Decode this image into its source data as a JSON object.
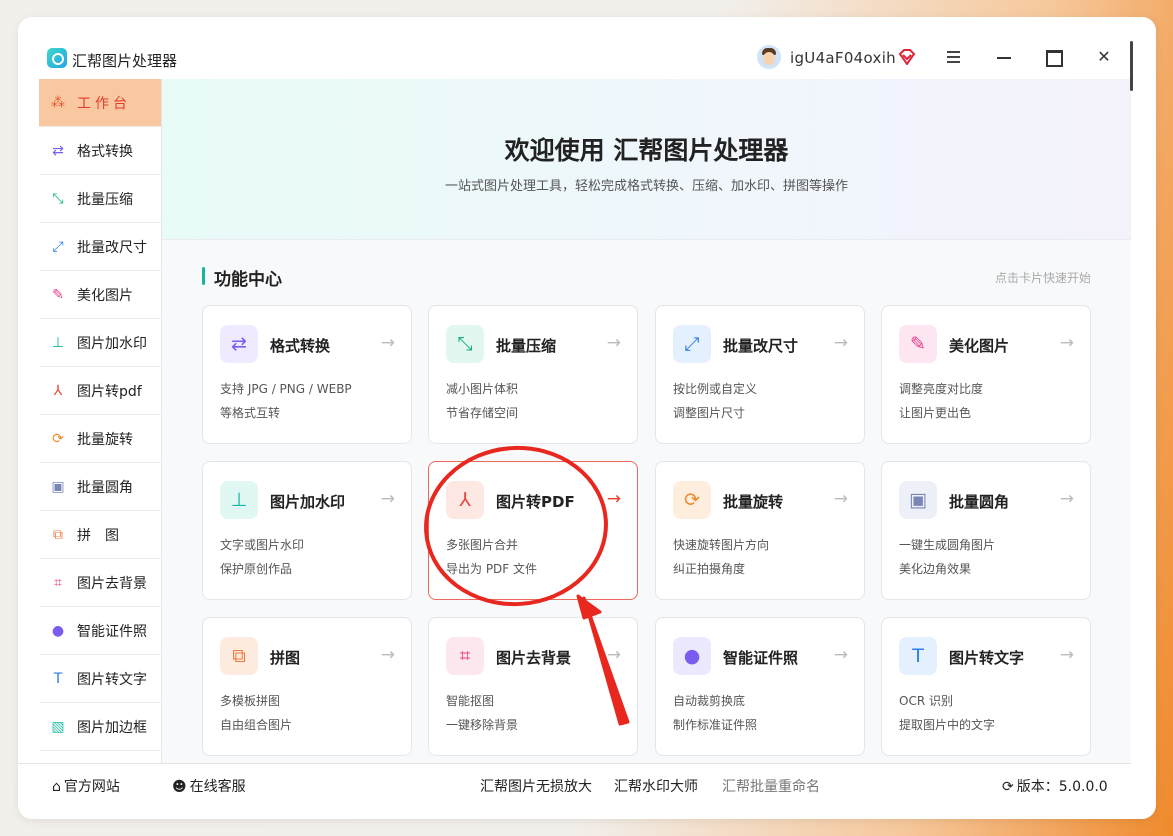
{
  "app": {
    "title": "汇帮图片处理器",
    "username": "igU4aF04oxih"
  },
  "sidebar": {
    "items": [
      {
        "label": "工作台",
        "icon": "grid-icon"
      },
      {
        "label": "格式转换",
        "icon": "format-convert-icon"
      },
      {
        "label": "批量压缩",
        "icon": "compress-icon"
      },
      {
        "label": "批量改尺寸",
        "icon": "resize-icon"
      },
      {
        "label": "美化图片",
        "icon": "beautify-icon"
      },
      {
        "label": "图片加水印",
        "icon": "watermark-icon"
      },
      {
        "label": "图片转pdf",
        "icon": "pdf-icon"
      },
      {
        "label": "批量旋转",
        "icon": "rotate-icon"
      },
      {
        "label": "批量圆角",
        "icon": "round-corner-icon"
      },
      {
        "label": "拼　图",
        "icon": "collage-icon"
      },
      {
        "label": "图片去背景",
        "icon": "crop-icon"
      },
      {
        "label": "智能证件照",
        "icon": "person-icon"
      },
      {
        "label": "图片转文字",
        "icon": "text-icon"
      },
      {
        "label": "图片加边框",
        "icon": "frame-icon"
      }
    ]
  },
  "hero": {
    "title": "欢迎使用 汇帮图片处理器",
    "subtitle": "一站式图片处理工具，轻松完成格式转换、压缩、加水印、拼图等操作"
  },
  "section": {
    "title": "功能中心",
    "hint": "点击卡片快速开始"
  },
  "cards": [
    {
      "title": "格式转换",
      "d1": "支持 JPG / PNG / WEBP",
      "d2": "等格式互转",
      "icon": "format-convert-icon"
    },
    {
      "title": "批量压缩",
      "d1": "减小图片体积",
      "d2": "节省存储空间",
      "icon": "compress-icon"
    },
    {
      "title": "批量改尺寸",
      "d1": "按比例或自定义",
      "d2": "调整图片尺寸",
      "icon": "resize-icon"
    },
    {
      "title": "美化图片",
      "d1": "调整亮度对比度",
      "d2": "让图片更出色",
      "icon": "beautify-icon"
    },
    {
      "title": "图片加水印",
      "d1": "文字或图片水印",
      "d2": "保护原创作品",
      "icon": "watermark-icon"
    },
    {
      "title": "图片转PDF",
      "d1": "多张图片合并",
      "d2": "导出为 PDF 文件",
      "icon": "pdf-icon"
    },
    {
      "title": "批量旋转",
      "d1": "快速旋转图片方向",
      "d2": "纠正拍摄角度",
      "icon": "rotate-icon"
    },
    {
      "title": "批量圆角",
      "d1": "一键生成圆角图片",
      "d2": "美化边角效果",
      "icon": "round-corner-icon"
    },
    {
      "title": "拼图",
      "d1": "多模板拼图",
      "d2": "自由组合图片",
      "icon": "collage-icon"
    },
    {
      "title": "图片去背景",
      "d1": "智能抠图",
      "d2": "一键移除背景",
      "icon": "crop-icon"
    },
    {
      "title": "智能证件照",
      "d1": "自动裁剪换底",
      "d2": "制作标准证件照",
      "icon": "person-icon"
    },
    {
      "title": "图片转文字",
      "d1": "OCR 识别",
      "d2": "提取图片中的文字",
      "icon": "text-icon"
    }
  ],
  "arrow_glyph": "→",
  "footer": {
    "website": "官方网站",
    "support": "在线客服",
    "link1": "汇帮图片无损放大",
    "link2": "汇帮水印大师",
    "link3": "汇帮批量重命名",
    "version": "版本：5.0.0.0"
  },
  "colors": {
    "accent": "#1cb59b",
    "active_bg": "#f9c8a0",
    "annotation": "#e8271f"
  }
}
